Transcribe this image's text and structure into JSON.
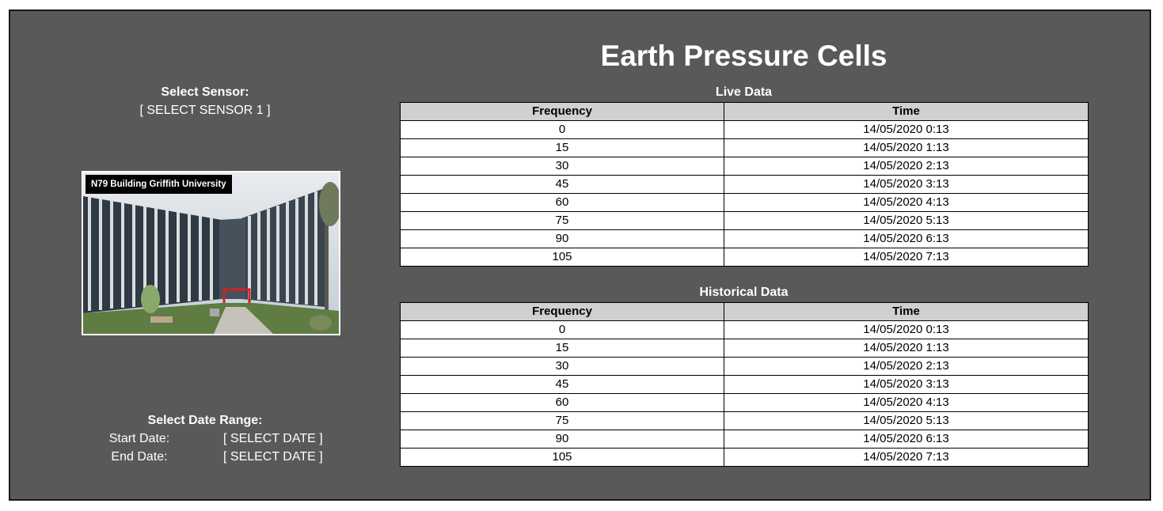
{
  "page": {
    "title": "Earth Pressure Cells"
  },
  "sensor": {
    "label": "Select Sensor:",
    "selected": "[ SELECT SENSOR 1 ]"
  },
  "photo": {
    "caption": "N79 Building Griffith University"
  },
  "date_range": {
    "label": "Select Date Range:",
    "start_label": "Start Date:",
    "start_value": "[ SELECT DATE ]",
    "end_label": "End Date:",
    "end_value": "[ SELECT DATE ]"
  },
  "live": {
    "title": "Live Data",
    "headers": [
      "Frequency",
      "Time"
    ],
    "rows": [
      [
        "0",
        "14/05/2020 0:13"
      ],
      [
        "15",
        "14/05/2020 1:13"
      ],
      [
        "30",
        "14/05/2020 2:13"
      ],
      [
        "45",
        "14/05/2020 3:13"
      ],
      [
        "60",
        "14/05/2020 4:13"
      ],
      [
        "75",
        "14/05/2020 5:13"
      ],
      [
        "90",
        "14/05/2020 6:13"
      ],
      [
        "105",
        "14/05/2020 7:13"
      ]
    ]
  },
  "historical": {
    "title": "Historical Data",
    "headers": [
      "Frequency",
      "Time"
    ],
    "rows": [
      [
        "0",
        "14/05/2020 0:13"
      ],
      [
        "15",
        "14/05/2020 1:13"
      ],
      [
        "30",
        "14/05/2020 2:13"
      ],
      [
        "45",
        "14/05/2020 3:13"
      ],
      [
        "60",
        "14/05/2020 4:13"
      ],
      [
        "75",
        "14/05/2020 5:13"
      ],
      [
        "90",
        "14/05/2020 6:13"
      ],
      [
        "105",
        "14/05/2020 7:13"
      ]
    ]
  },
  "colors": {
    "background": "#595959",
    "header_fill": "#d0d0d0",
    "text_light": "#ffffff"
  }
}
